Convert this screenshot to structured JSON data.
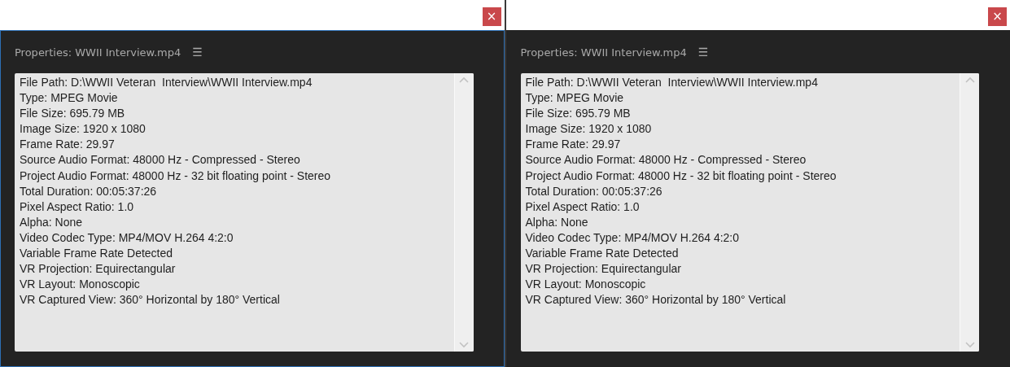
{
  "panels": [
    {
      "focused": true,
      "title": "Properties: WWII Interview.mp4",
      "menu_icon": "☰",
      "close": "×",
      "lines": [
        "File Path: D:\\WWII Veteran  Interview\\WWII Interview.mp4",
        "Type: MPEG Movie",
        "File Size: 695.79 MB",
        "Image Size: 1920 x 1080",
        "Frame Rate: 29.97",
        "Source Audio Format: 48000 Hz - Compressed - Stereo",
        "Project Audio Format: 48000 Hz - 32 bit floating point - Stereo",
        "Total Duration: 00:05:37:26",
        "Pixel Aspect Ratio: 1.0",
        "Alpha: None",
        "Video Codec Type: MP4/MOV H.264 4:2:0",
        "Variable Frame Rate Detected",
        "VR Projection: Equirectangular",
        "VR Layout: Monoscopic",
        "VR Captured View: 360° Horizontal by 180° Vertical"
      ]
    },
    {
      "focused": false,
      "title": "Properties: WWII Interview.mp4",
      "menu_icon": "☰",
      "close": "×",
      "lines": [
        "File Path: D:\\WWII Veteran  Interview\\WWII Interview.mp4",
        "Type: MPEG Movie",
        "File Size: 695.79 MB",
        "Image Size: 1920 x 1080",
        "Frame Rate: 29.97",
        "Source Audio Format: 48000 Hz - Compressed - Stereo",
        "Project Audio Format: 48000 Hz - 32 bit floating point - Stereo",
        "Total Duration: 00:05:37:26",
        "Pixel Aspect Ratio: 1.0",
        "Alpha: None",
        "Video Codec Type: MP4/MOV H.264 4:2:0",
        "Variable Frame Rate Detected",
        "VR Projection: Equirectangular",
        "VR Layout: Monoscopic",
        "VR Captured View: 360° Horizontal by 180° Vertical"
      ]
    }
  ]
}
